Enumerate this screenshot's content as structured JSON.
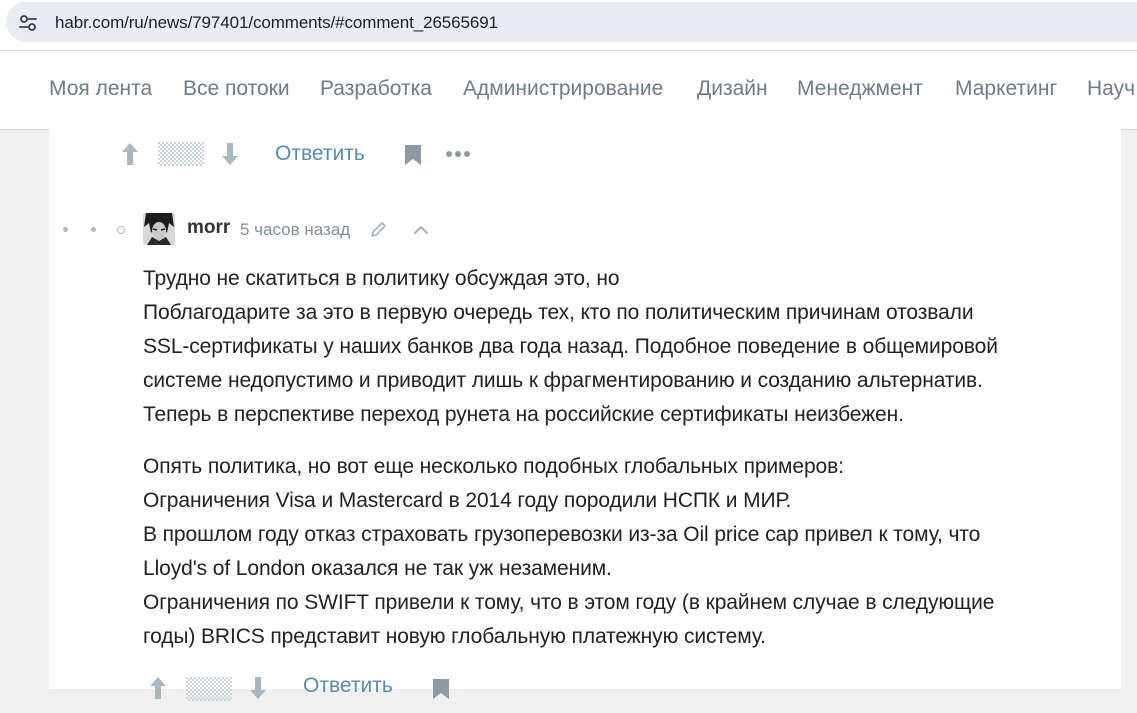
{
  "browser": {
    "url": "habr.com/ru/news/797401/comments/#comment_26565691",
    "site_info_icon": "tune-icon"
  },
  "nav": {
    "items": [
      "Моя лента",
      "Все потоки",
      "Разработка",
      "Администрирование",
      "Дизайн",
      "Менеджмент",
      "Маркетинг",
      "Науч"
    ]
  },
  "top_actions": {
    "upvote_icon": "arrow-up-icon",
    "downvote_icon": "arrow-down-icon",
    "reply_label": "Ответить",
    "bookmark_icon": "bookmark-icon",
    "more_icon": "more-dots-icon"
  },
  "comment": {
    "author": "morr",
    "time": "5 часов назад",
    "edit_icon": "pencil-icon",
    "collapse_icon": "chevron-up-icon",
    "paragraphs": [
      [
        "Трудно не скатиться в политику обсуждая это, но",
        "Поблагодарите за это в первую очередь тех, кто по политическим причинам отозвали",
        "SSL-сертификаты у наших банков два года назад. Подобное поведение в общемировой",
        "системе недопустимо и приводит лишь к фрагментированию и созданию альтернатив.",
        "Теперь в перспективе переход рунета на российские сертификаты неизбежен."
      ],
      [
        "Опять политика, но вот еще несколько подобных глобальных примеров:",
        "Ограничения Visa и Mastercard в 2014 году породили НСПК и МИР.",
        "В прошлом году отказ страховать грузоперевозки из-за Oil price cap привел к тому, что",
        "Lloyd's of London оказался не так уж незаменим.",
        "Ограничения по SWIFT привели к тому, что в этом году (в крайнем случае в следующие",
        "годы) BRICS представит новую глобальную платежную систему."
      ]
    ]
  },
  "colors": {
    "accent": "#548eaa",
    "text": "#222222",
    "muted": "#838e96",
    "nav_text": "#6f7c85"
  }
}
